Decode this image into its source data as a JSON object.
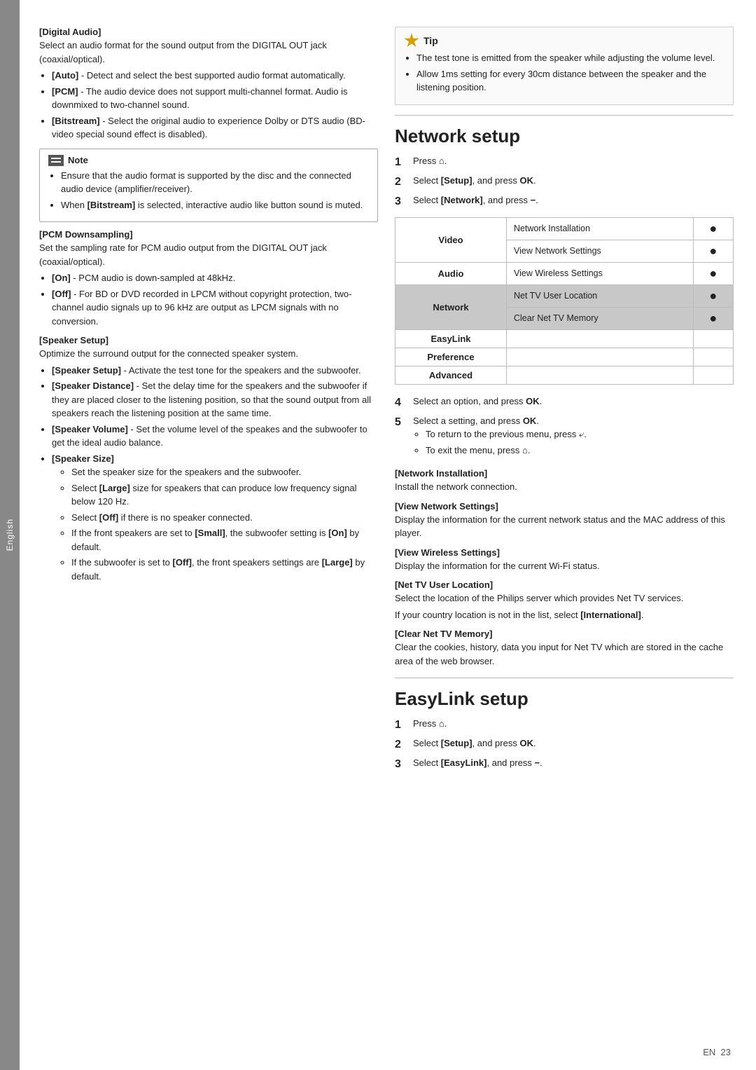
{
  "sidebar": {
    "label": "English"
  },
  "left_column": {
    "digital_audio_heading": "[Digital Audio]",
    "digital_audio_intro": "Select an audio format for the sound output from the DIGITAL OUT jack (coaxial/optical).",
    "digital_audio_items": [
      "[Auto] - Detect and select the best supported audio format automatically.",
      "[PCM] - The audio device does not support multi-channel format. Audio is downmixed to two-channel sound.",
      "[Bitstream] - Select the original audio to experience Dolby or DTS audio (BD-video special sound effect is disabled)."
    ],
    "note_header": "Note",
    "note_items": [
      "Ensure that the audio format is supported by the disc and the connected audio device (amplifier/receiver).",
      "When [Bitstream] is selected, interactive audio like button sound is muted."
    ],
    "pcm_heading": "[PCM Downsampling]",
    "pcm_intro": "Set the sampling rate for PCM audio output from the DIGITAL OUT jack (coaxial/optical).",
    "pcm_items": [
      "[On] - PCM audio is down-sampled at 48kHz.",
      "[Off] - For BD or DVD recorded in LPCM without copyright protection, two-channel audio signals up to 96 kHz are output as LPCM signals with no conversion."
    ],
    "speaker_heading": "[Speaker Setup]",
    "speaker_intro": "Optimize the surround output for the connected speaker system.",
    "speaker_items": [
      {
        "label": "[Speaker Setup]",
        "desc": " - Activate the test tone for the speakers and the subwoofer."
      },
      {
        "label": "[Speaker Distance]",
        "desc": " - Set the delay time for the speakers and the subwoofer if they are placed closer to the listening position, so that the sound output from all speakers reach the listening position at the same time."
      },
      {
        "label": "[Speaker Volume]",
        "desc": " - Set the volume level of the speakes and the subwoofer to get the ideal audio balance."
      }
    ],
    "speaker_size_label": "[Speaker Size]",
    "speaker_size_sub": [
      "Set the speaker size for the speakers and the subwoofer.",
      "Select [Large] size for speakers that can produce low frequency signal below 120 Hz.",
      "Select [Off] if there is no speaker connected.",
      "If the front speakers are set to [Small], the subwoofer setting is [On] by default.",
      "If the subwoofer is set to [Off], the front speakers settings are [Large] by default."
    ]
  },
  "right_column": {
    "tip_header": "Tip",
    "tip_items": [
      "The test tone is emitted from the speaker while adjusting the volume level.",
      "Allow 1ms setting for every 30cm distance between the speaker and the listening position."
    ],
    "network_setup_heading": "Network setup",
    "network_steps": [
      {
        "num": "1",
        "text": "Press ",
        "icon": "home"
      },
      {
        "num": "2",
        "text": "Select [Setup], and press OK."
      },
      {
        "num": "3",
        "text": "Select [Network], and press −."
      }
    ],
    "menu_table": {
      "rows": [
        {
          "cat": "Video",
          "items": [
            {
              "label": "Network Installation",
              "dot": true
            },
            {
              "label": "View Network Settings",
              "dot": true
            }
          ]
        },
        {
          "cat": "Audio",
          "items": [
            {
              "label": "View Wireless Settings",
              "dot": true
            }
          ]
        },
        {
          "cat": "Network",
          "items": [
            {
              "label": "Net TV User Location",
              "dot": true
            },
            {
              "label": "Clear Net TV Memory",
              "dot": true
            }
          ],
          "highlight": true
        },
        {
          "cat": "EasyLink",
          "items": []
        },
        {
          "cat": "Preference",
          "items": []
        },
        {
          "cat": "Advanced",
          "items": []
        }
      ]
    },
    "steps_after": [
      {
        "num": "4",
        "text": "Select an option, and press OK."
      },
      {
        "num": "5",
        "text": "Select a setting, and press OK."
      }
    ],
    "return_bullets": [
      "To return to the previous menu, press ↩.",
      "To exit the menu, press 🏠."
    ],
    "network_installation_heading": "[Network Installation]",
    "network_installation_text": "Install the network connection.",
    "view_network_heading": "[View Network Settings]",
    "view_network_text": "Display the information for the current network status and the MAC address of this player.",
    "view_wireless_heading": "[View Wireless Settings]",
    "view_wireless_text": "Display the information for the current Wi-Fi status.",
    "net_tv_location_heading": "[Net TV User Location]",
    "net_tv_location_text1": "Select the location of the Philips server which provides Net TV services.",
    "net_tv_location_text2": "If your country location is not in the list, select [International].",
    "clear_net_heading": "[Clear Net TV Memory]",
    "clear_net_text": "Clear the cookies, history, data you input for Net TV which are stored in the cache area of the web browser.",
    "easylink_heading": "EasyLink setup",
    "easylink_steps": [
      {
        "num": "1",
        "text": "Press ",
        "icon": "home"
      },
      {
        "num": "2",
        "text": "Select [Setup], and press OK."
      },
      {
        "num": "3",
        "text": "Select [EasyLink], and press −."
      }
    ]
  },
  "footer": {
    "lang": "EN",
    "page": "23"
  }
}
